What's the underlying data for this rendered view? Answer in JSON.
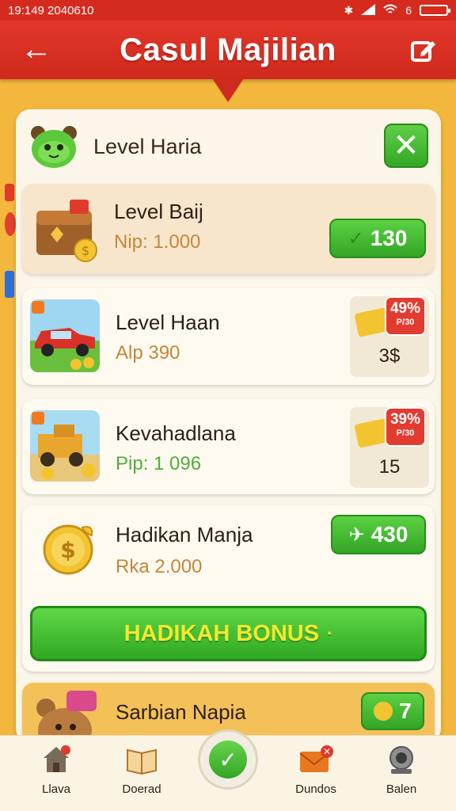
{
  "status_bar": {
    "time": "19:149 2040610",
    "signal": "6"
  },
  "header": {
    "title": "Casul Majilian",
    "back_icon": "back-arrow-icon",
    "edit_icon": "edit-icon"
  },
  "panel": {
    "title": "Level Haria",
    "close_label": "✕",
    "items": [
      {
        "title": "Level Baij",
        "sub": "Nip: 1.000",
        "button": "130"
      },
      {
        "title": "Level Haan",
        "sub": "Alp 390",
        "discount": "49%",
        "discount_small": "P/30",
        "count": "3$"
      },
      {
        "title": "Kevahadlana",
        "sub": "Pip: 1 096",
        "discount": "39%",
        "discount_small": "P/30",
        "count": "15"
      },
      {
        "title": "Hadikan Manja",
        "sub": "Rka 2.000",
        "button": "430"
      },
      {
        "title": "Sarbian Napia",
        "sub": "",
        "button": "7"
      }
    ],
    "bonus_label": "HADIKAH BONUS",
    "bonus_suffix": "·"
  },
  "nav": [
    {
      "label": "Llava",
      "icon": "home-icon"
    },
    {
      "label": "Doerad",
      "icon": "book-icon"
    },
    {
      "label": "",
      "icon": "check-icon"
    },
    {
      "label": "Dundos",
      "icon": "mail-icon"
    },
    {
      "label": "Balen",
      "icon": "camera-icon"
    }
  ],
  "colors": {
    "header": "#d52b1e",
    "background": "#f2b73c",
    "button": "#34a526",
    "bonus_text": "#f3e92f"
  }
}
